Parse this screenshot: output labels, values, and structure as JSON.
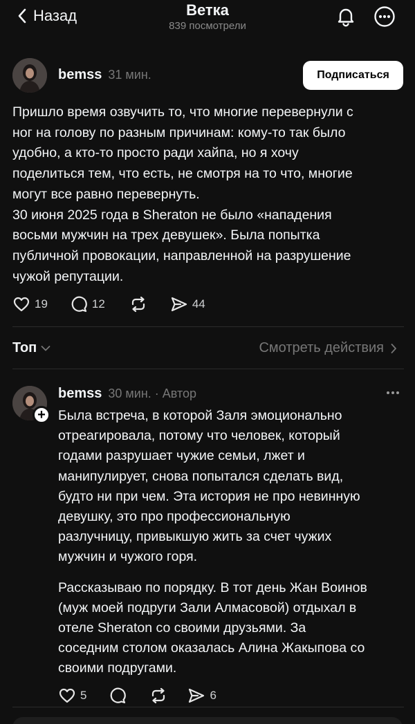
{
  "nav": {
    "back_label": "Назад",
    "title": "Ветка",
    "views": "839 посмотрели"
  },
  "post": {
    "username": "bemss",
    "time": "31 мин.",
    "follow_label": "Подписаться",
    "lines": [
      "Пришло время озвучить то, что многие перевернули с",
      "ног на голову по разным причинам: кому-то так было",
      "удобно, а кто-то просто ради хайпа, но я хочу",
      "поделиться тем, что есть, не смотря на то что, многие",
      "могут все равно перевернуть.",
      "30 июня 2025 года в Sheraton не было «нападения",
      "восьми мужчин на трех девушек». Была попытка",
      "публичной провокации, направленной на разрушение",
      "чужой репутации."
    ],
    "likes": "19",
    "comments": "12",
    "shares": "44"
  },
  "sort": {
    "label": "Топ",
    "activity_label": "Смотреть действия"
  },
  "reply": {
    "username": "bemss",
    "meta": "30 мин. · Автор",
    "paragraph1": [
      "Была встреча, в которой Заля эмоционально",
      "отреагировала, потому что человек, который",
      "годами разрушает чужие семьи, лжет и",
      "манипулирует, снова попытался сделать вид,",
      "будто ни при чем. Эта история не про невинную",
      "девушку, это про профессиональную",
      "разлучницу, привыкшую жить за счет чужих",
      "мужчин и чужого горя."
    ],
    "paragraph2": [
      "Рассказываю по порядку. В тот день Жан Воинов",
      "(муж моей подруги Зали Алмасовой) отдыхал в",
      "отеле Sheraton со своими друзьями. За",
      "соседним столом оказалась Алина Жакыпова со",
      "своими подругами."
    ],
    "likes": "5",
    "shares": "6"
  }
}
